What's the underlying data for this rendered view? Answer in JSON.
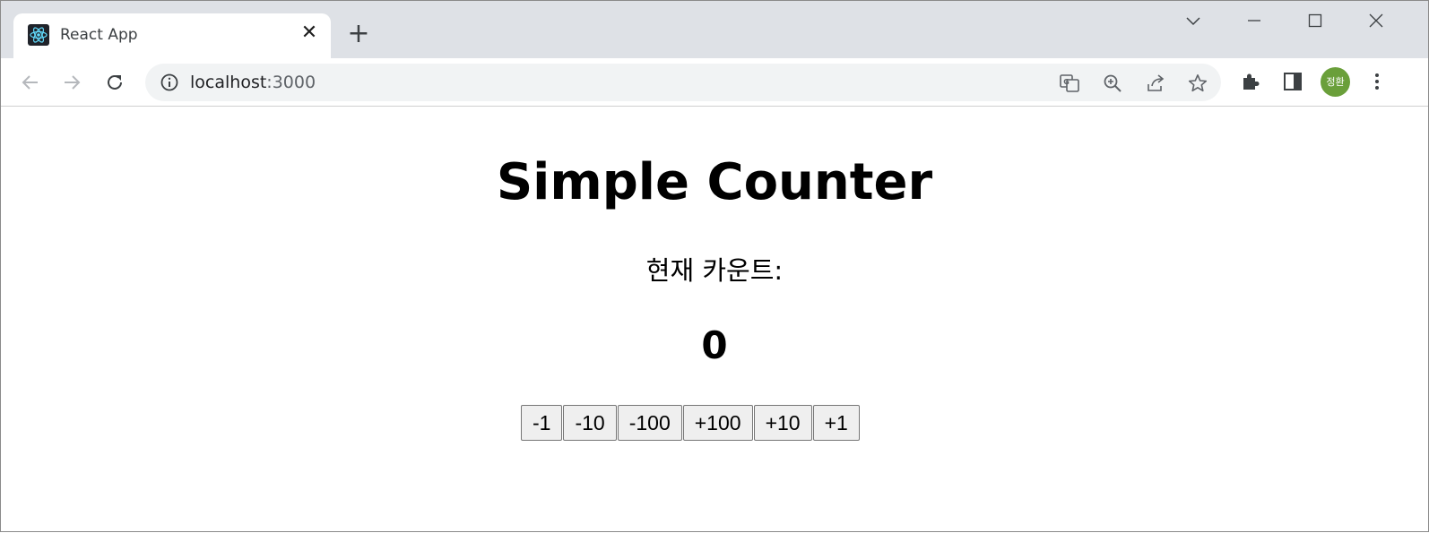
{
  "browser": {
    "tab_title": "React App",
    "close_glyph": "✕",
    "new_tab_glyph": "+",
    "url_host": "localhost",
    "url_port": ":3000",
    "profile_initials": "정환",
    "profile_color": "#6a9f3a"
  },
  "page": {
    "title": "Simple Counter",
    "count_label": "현재 카운트:",
    "count_value": "0",
    "buttons": [
      "-1",
      "-10",
      "-100",
      "+100",
      "+10",
      "+1"
    ]
  }
}
